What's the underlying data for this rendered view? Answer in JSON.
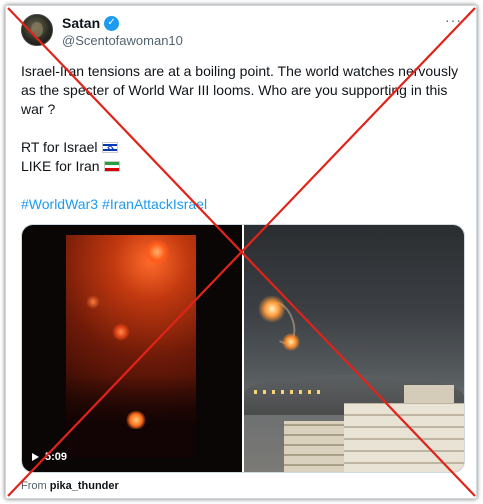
{
  "author": {
    "display_name": "Satan",
    "handle": "@Scentofawoman10",
    "verified_mark": "✓"
  },
  "more_icon": "···",
  "tweet": {
    "text": "Israel-Iran tensions are at a boiling point. The world watches nervously as the specter of World War III looms. Who are you supporting in this war ?",
    "rt_line": "RT for Israel",
    "like_line": "LIKE  for Iran",
    "hashtags": [
      "#WorldWar3",
      "#IranAttackIsrael"
    ]
  },
  "media": {
    "video_duration": "5:09",
    "source_prefix": "From",
    "source_name": "pika_thunder"
  },
  "icons": {
    "verified": "verified-badge-icon",
    "play": "play-icon",
    "israel_flag": "israel-flag-icon",
    "iran_flag": "iran-flag-icon"
  },
  "colors": {
    "link": "#1d9bf0",
    "muted": "#536471",
    "text": "#0f1419",
    "verified": "#1d9bf0",
    "cross": "#e2231a"
  }
}
